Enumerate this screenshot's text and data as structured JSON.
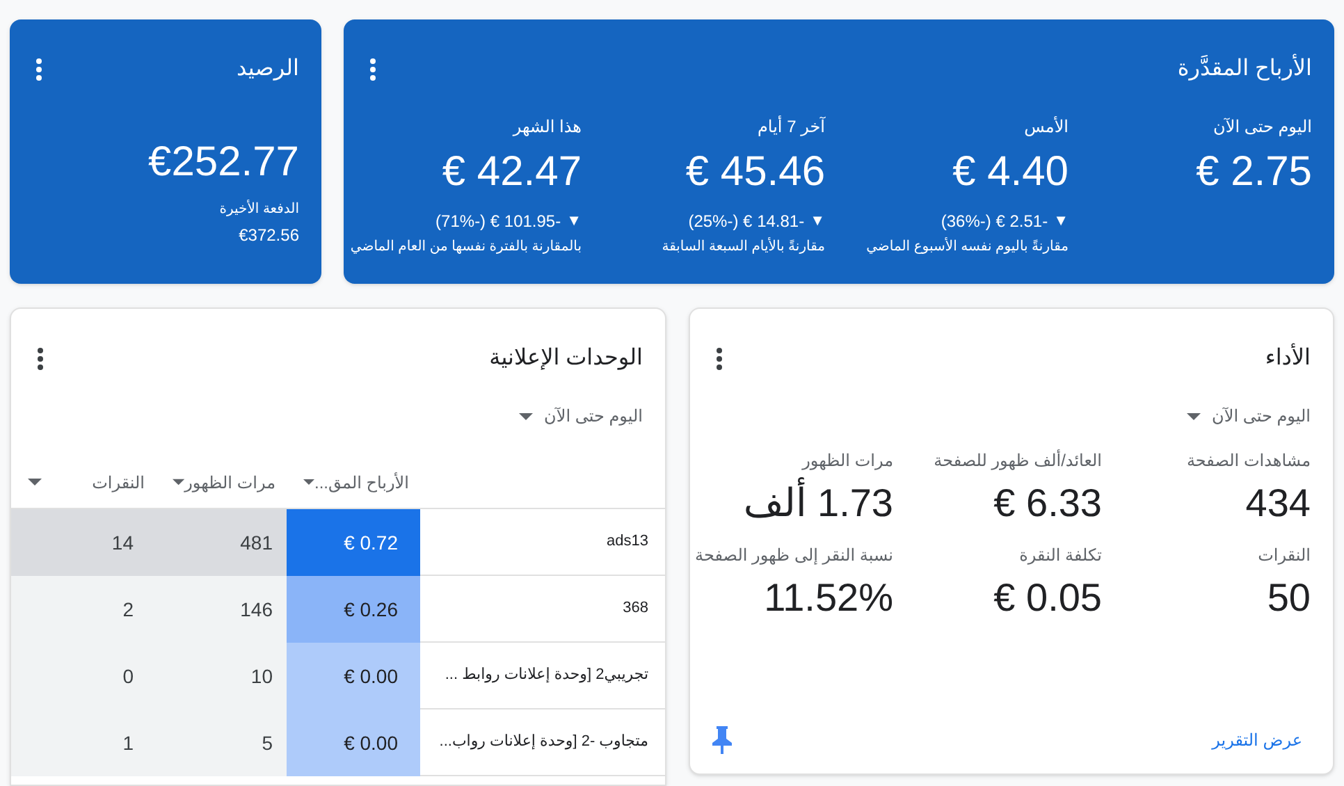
{
  "estimated_earnings": {
    "title": "الأرباح المقدَّرة",
    "stats": [
      {
        "label": "اليوم حتى الآن",
        "value": "€ 2.75"
      },
      {
        "label": "الأمس",
        "value": "€ 4.40",
        "trend": "▼",
        "change": "-2.51 € (-36%)",
        "comparison": "مقارنةً باليوم نفسه الأسبوع الماضي"
      },
      {
        "label": "آخر 7 أيام",
        "value": "€ 45.46",
        "trend": "▼",
        "change": "-14.81 € (-25%)",
        "comparison": "مقارنةً بالأيام السبعة السابقة"
      },
      {
        "label": "هذا الشهر",
        "value": "€ 42.47",
        "trend": "▼",
        "change": "-101.95 € (-71%)",
        "comparison": "بالمقارنة بالفترة نفسها من العام الماضي"
      }
    ]
  },
  "balance": {
    "title": "الرصيد",
    "value": "€252.77",
    "last_payment_label": "الدفعة الأخيرة",
    "last_payment": "€372.56"
  },
  "performance": {
    "title": "الأداء",
    "range": "اليوم حتى الآن",
    "metrics": [
      {
        "label": "مشاهدات الصفحة",
        "value": "434"
      },
      {
        "label": "العائد/ألف ظهور للصفحة",
        "value": "€ 6.33"
      },
      {
        "label": "مرات الظهور",
        "value": "1.73 ألف"
      },
      {
        "label": "النقرات",
        "value": "50"
      },
      {
        "label": "تكلفة النقرة",
        "value": "€ 0.05"
      },
      {
        "label": "نسبة النقر إلى ظهور الصفحة",
        "value": "11.52%"
      }
    ],
    "report_link": "عرض التقرير"
  },
  "ad_units": {
    "title": "الوحدات الإعلانية",
    "range": "اليوم حتى الآن",
    "columns": [
      "الأرباح المق...",
      "مرات الظهور",
      "النقرات"
    ],
    "rows": [
      {
        "name": "ads13",
        "earnings": "€ 0.72",
        "impressions": "481",
        "clicks": "14",
        "color": "#1a73e8",
        "selected": true
      },
      {
        "name": "368",
        "earnings": "€ 0.26",
        "impressions": "146",
        "clicks": "2",
        "color": "#8ab4f8",
        "selected": false
      },
      {
        "name": "تجريبي2 [وحدة إعلانات روابط ...",
        "earnings": "€ 0.00",
        "impressions": "10",
        "clicks": "0",
        "color": "#aecbfa",
        "selected": false
      },
      {
        "name": "متجاوب -2 [وحدة إعلانات رواب...",
        "earnings": "€ 0.00",
        "impressions": "5",
        "clicks": "1",
        "color": "#aecbfa",
        "selected": false
      }
    ]
  }
}
